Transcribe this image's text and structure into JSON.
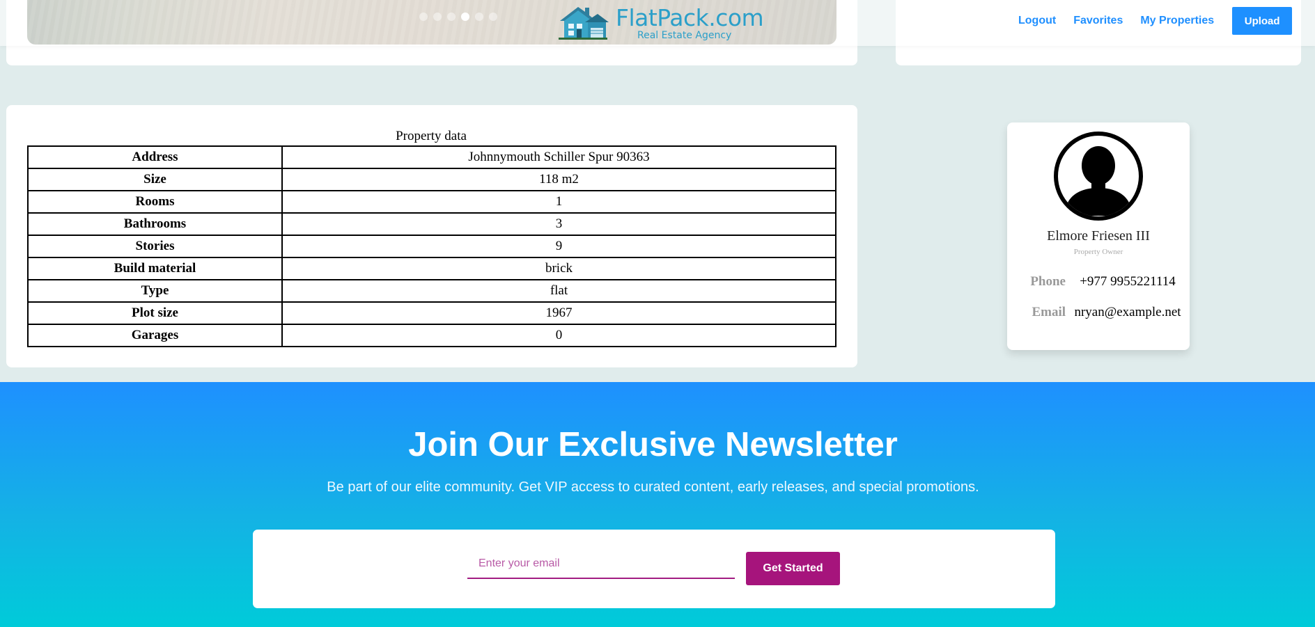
{
  "brand": {
    "name": "FlatPack.com",
    "tagline": "Real Estate Agency"
  },
  "nav": {
    "logout": "Logout",
    "favorites": "Favorites",
    "my_properties": "My Properties",
    "upload": "Upload"
  },
  "carousel": {
    "slide_count": 6,
    "active_index": 3
  },
  "property": {
    "caption": "Property data",
    "rows": [
      {
        "label": "Address",
        "value": "Johnnymouth Schiller Spur 90363"
      },
      {
        "label": "Size",
        "value": "118 m2"
      },
      {
        "label": "Rooms",
        "value": "1"
      },
      {
        "label": "Bathrooms",
        "value": "3"
      },
      {
        "label": "Stories",
        "value": "9"
      },
      {
        "label": "Build material",
        "value": "brick"
      },
      {
        "label": "Type",
        "value": "flat"
      },
      {
        "label": "Plot size",
        "value": "1967"
      },
      {
        "label": "Garages",
        "value": "0"
      }
    ]
  },
  "owner": {
    "name": "Elmore Friesen III",
    "role": "Property Owner",
    "phone_label": "Phone",
    "phone": "+977 9955221114",
    "email_label": "Email",
    "email": "nryan@example.net"
  },
  "newsletter": {
    "title": "Join Our Exclusive Newsletter",
    "subtitle": "Be part of our elite community. Get VIP access to curated content, early releases, and special promotions.",
    "email_placeholder": "Enter your email",
    "button": "Get Started"
  },
  "colors": {
    "accent_blue": "#1e90ff",
    "brand_teal": "#2b9fc9",
    "cta_magenta": "#a6147c",
    "page_bg": "#e0ecec"
  }
}
